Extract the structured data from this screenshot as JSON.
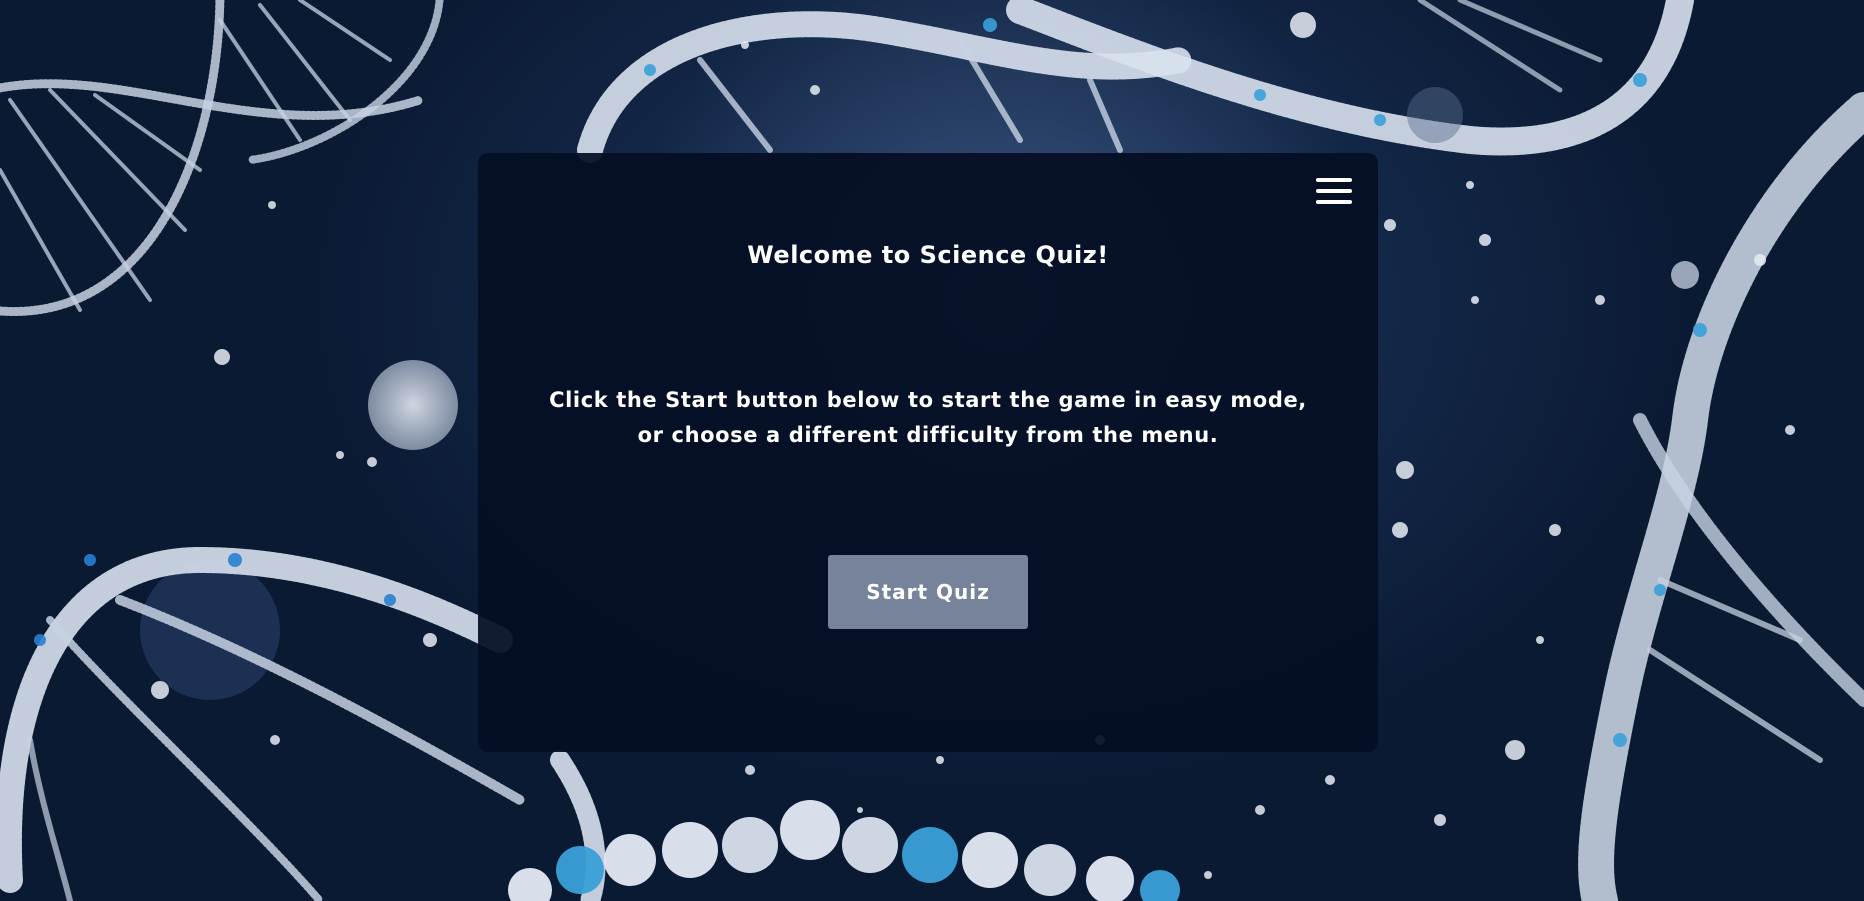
{
  "quiz": {
    "title": "Welcome to Science Quiz!",
    "instructions": [
      "Click the Start button below to start the game in easy mode,",
      "or choose a different difficulty from the menu."
    ],
    "start_label": "Start Quiz"
  },
  "icons": {
    "menu": "hamburger-menu-icon"
  },
  "colors": {
    "background": "#152a4c",
    "card": "#040e24",
    "button": "#76839a",
    "text": "#ffffff"
  }
}
